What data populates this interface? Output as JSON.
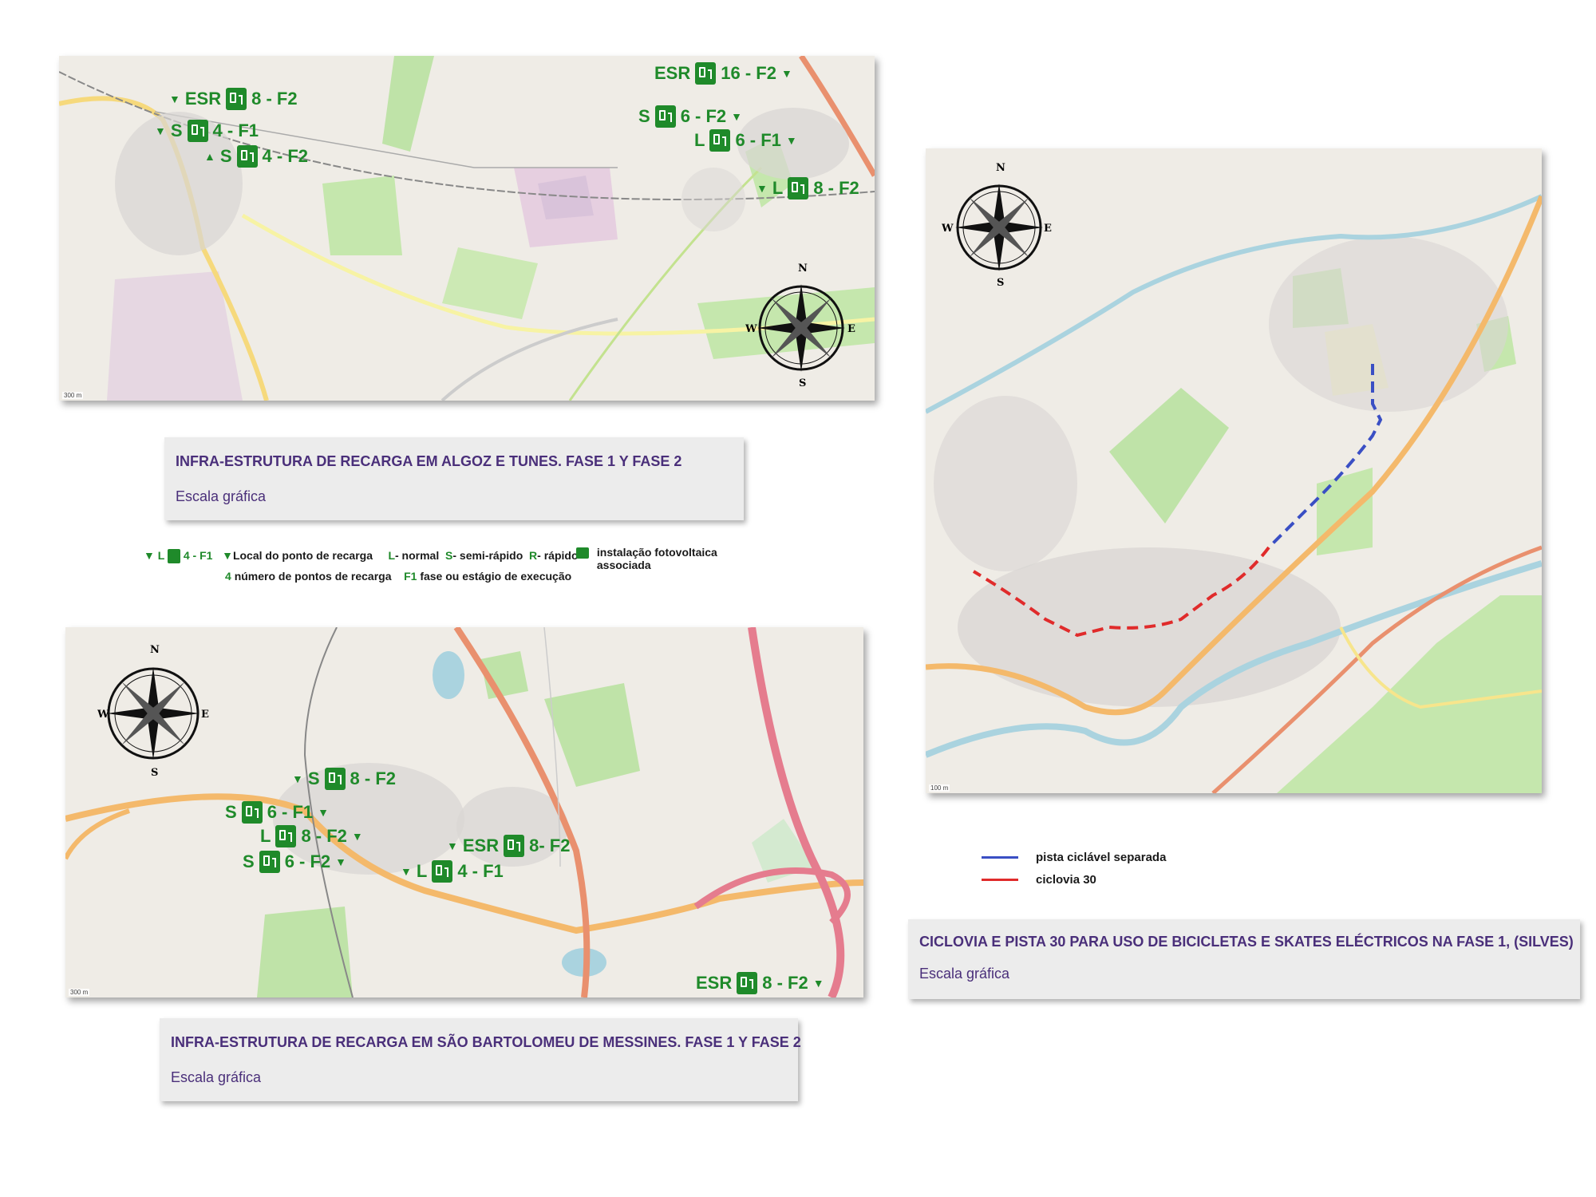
{
  "maps": {
    "algoz_tunes": {
      "caption_title": "INFRA-ESTRUTURA DE RECARGA EM ALGOZ E TUNES. FASE 1 Y FASE 2",
      "caption_subtitle": "Escala gráfica",
      "scale_label": "300 m",
      "markers": [
        {
          "type": "ESR",
          "label": "8 - F2"
        },
        {
          "type": "S",
          "label": "4 - F1"
        },
        {
          "type": "S",
          "label": "4 - F2"
        },
        {
          "type": "ESR",
          "label": "16 - F2"
        },
        {
          "type": "S",
          "label": "6 - F2"
        },
        {
          "type": "L",
          "label": "6 - F1"
        },
        {
          "type": "L",
          "label": "8 - F2"
        }
      ]
    },
    "messines": {
      "caption_title": "INFRA-ESTRUTURA DE RECARGA EM SÃO BARTOLOMEU DE MESSINES. FASE 1 Y FASE 2",
      "caption_subtitle": "Escala gráfica",
      "scale_label": "300 m",
      "markers": [
        {
          "type": "S",
          "label": "8 - F2"
        },
        {
          "type": "S",
          "label": "6 - F1"
        },
        {
          "type": "L",
          "label": "8 - F2"
        },
        {
          "type": "S",
          "label": "6 - F2"
        },
        {
          "type": "ESR",
          "label": "8- F2"
        },
        {
          "type": "L",
          "label": "4 - F1"
        },
        {
          "type": "ESR",
          "label": "8 - F2"
        }
      ]
    },
    "silves": {
      "caption_title": "CICLOVIA E PISTA 30 PARA USO DE BICICLETAS E SKATES ELÉCTRICOS NA FASE 1, (SILVES)",
      "caption_subtitle": "Escala gráfica",
      "scale_label": "100 m"
    }
  },
  "legend": {
    "example_type": "L",
    "example_label": "4 - F1",
    "local_label": "Local do ponto de recarga",
    "normal_prefix": "L",
    "normal_label": "- normal",
    "semi_prefix": "S",
    "semi_label": "- semi-rápido",
    "rapid_prefix": "R",
    "rapid_label": "- rápido",
    "pv_label_1": "instalação fotovoltaica",
    "pv_label_2": "associada",
    "count_prefix": "4",
    "count_label": "número de pontos de recarga",
    "phase_prefix": "F1",
    "phase_label": "fase ou estágio de execução"
  },
  "route_legend": {
    "blue_label": "pista ciclável separada",
    "red_label": "ciclovia 30",
    "blue_color": "#3a4fc4",
    "red_color": "#e02b2b"
  },
  "compass": {
    "n": "N",
    "s": "S",
    "e": "E",
    "w": "W"
  }
}
